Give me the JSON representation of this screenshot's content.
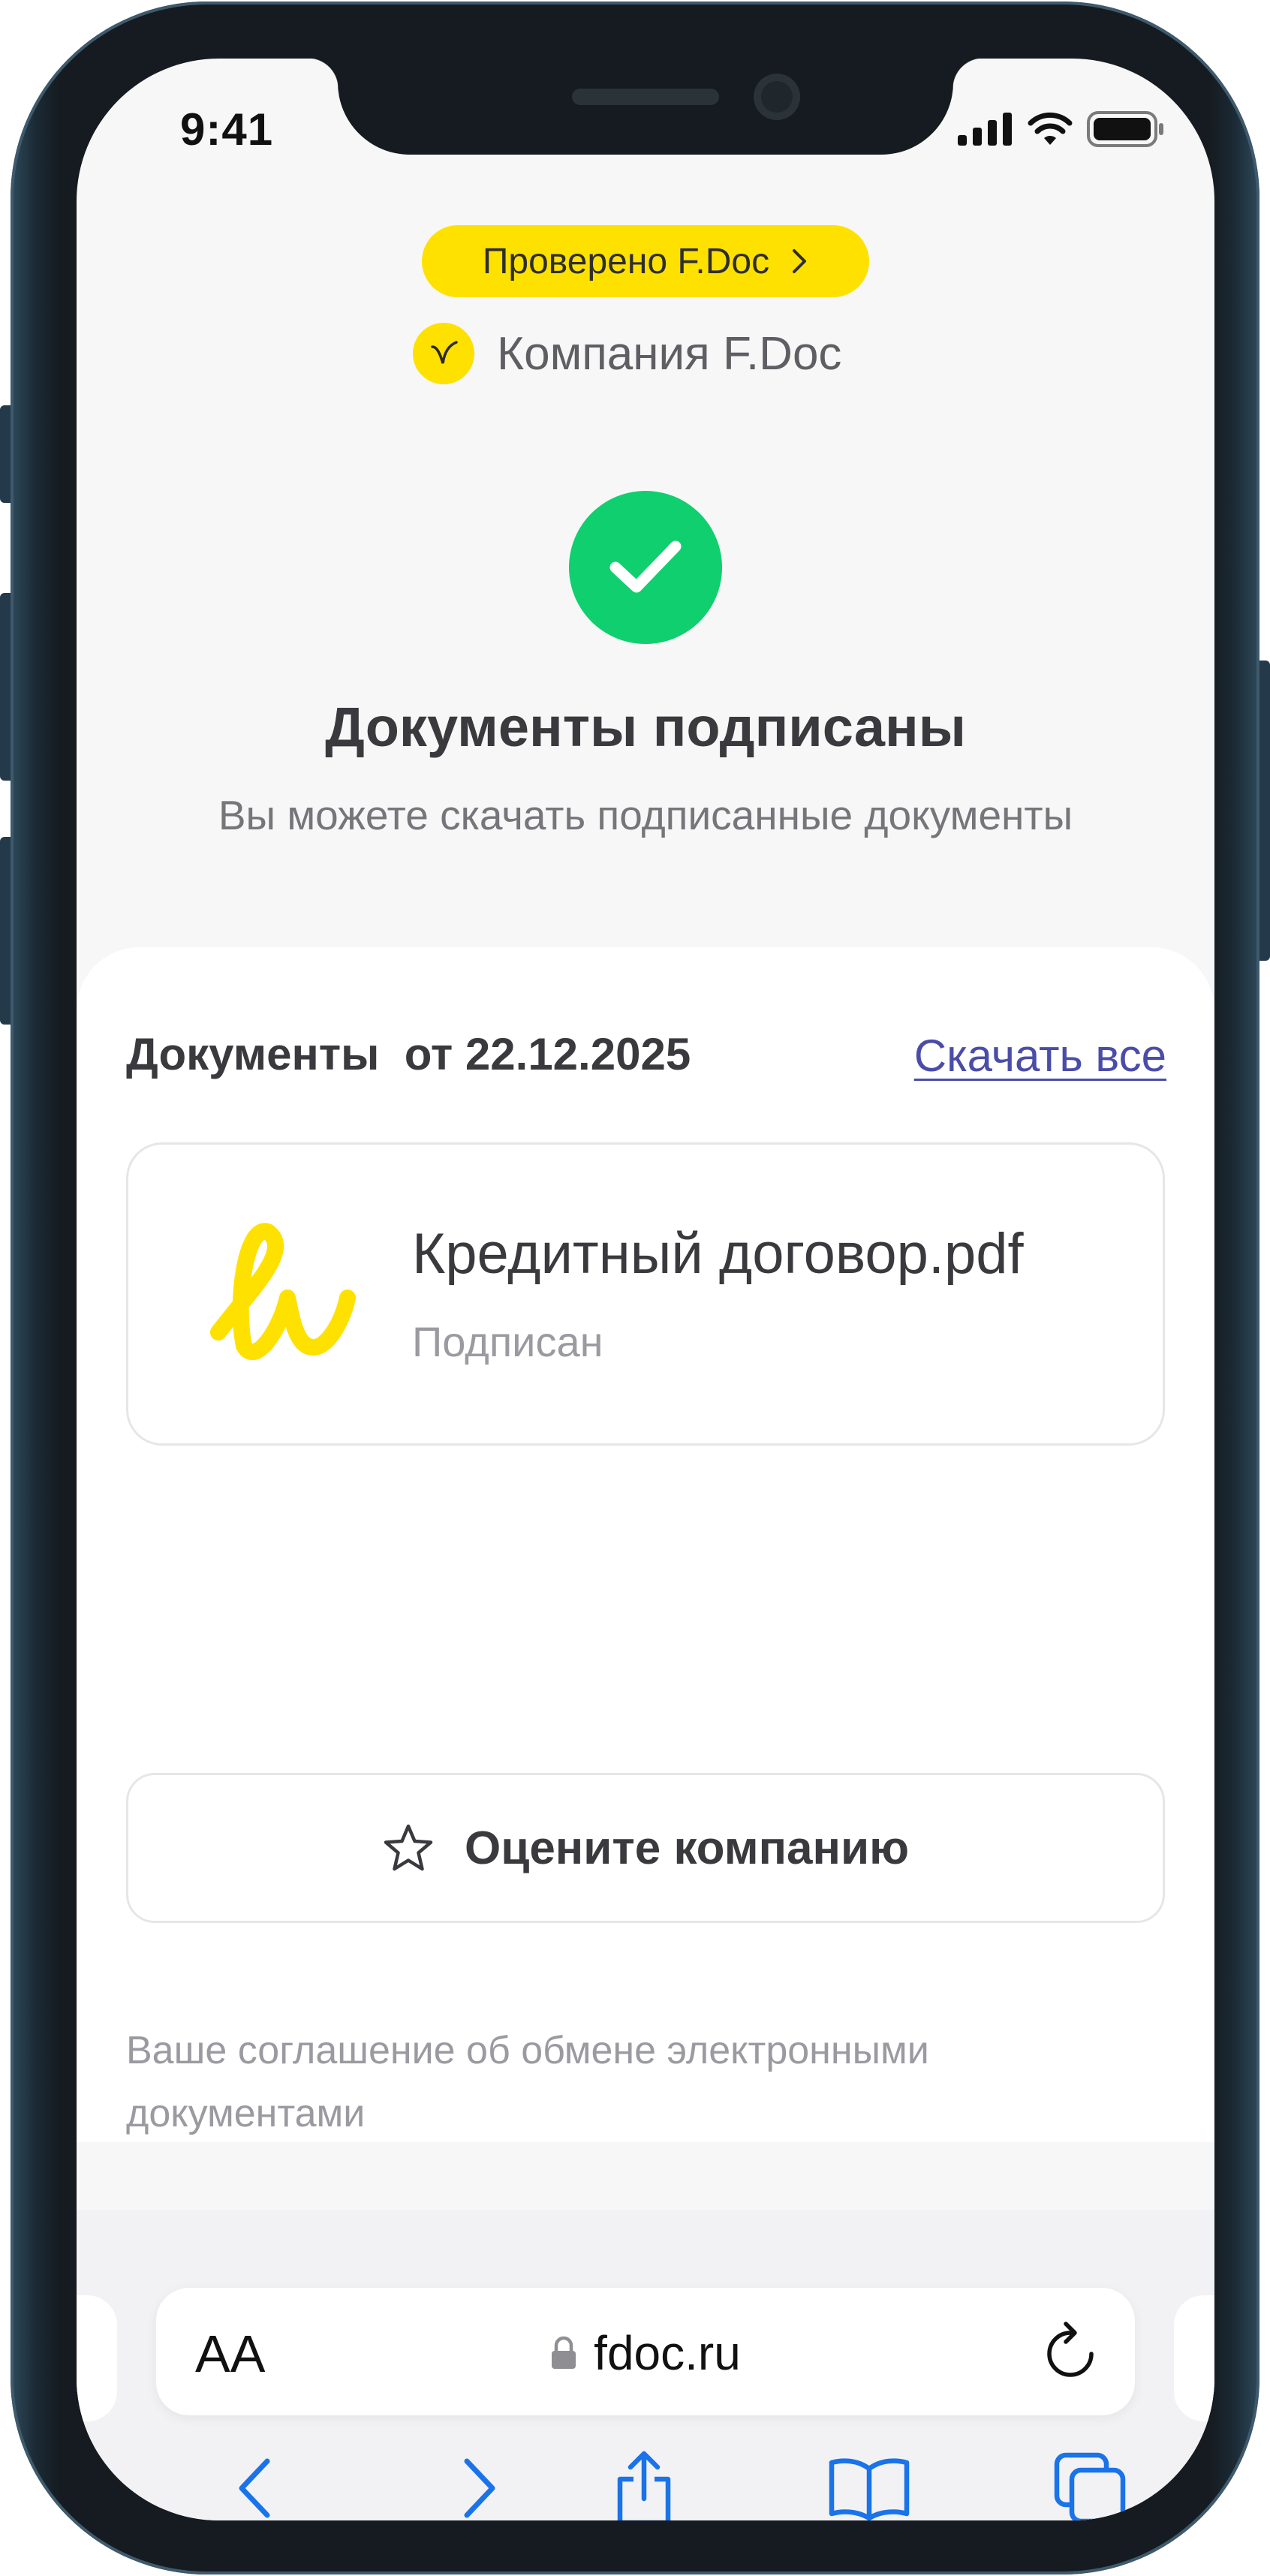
{
  "status_bar": {
    "time": "9:41",
    "icons": [
      "cellular-signal-icon",
      "wifi-icon",
      "battery-icon"
    ]
  },
  "header": {
    "verified_badge": "Проверено F.Doc",
    "company_name": "Компания F.Doc"
  },
  "result": {
    "title": "Документы подписаны",
    "subtitle": "Вы можете скачать подписанные документы"
  },
  "documents": {
    "section_label": "Документы  от 22.12.2025",
    "download_all": "Скачать все",
    "items": [
      {
        "name": "Кредитный договор.pdf",
        "status": "Подписан"
      }
    ]
  },
  "rate_button": {
    "label": "Оцените компанию"
  },
  "agreement_text": "Ваше соглашение об обмене электронными документами",
  "browser": {
    "text_size_label": "AA",
    "url": "fdoc.ru",
    "toolbar_icons": [
      "back-icon",
      "forward-icon",
      "share-icon",
      "bookmarks-icon",
      "tabs-icon"
    ]
  },
  "colors": {
    "brand_yellow": "#ffe100",
    "success_green": "#10cf6e",
    "link": "#4a4da8",
    "safari_blue": "#1a73e8"
  }
}
